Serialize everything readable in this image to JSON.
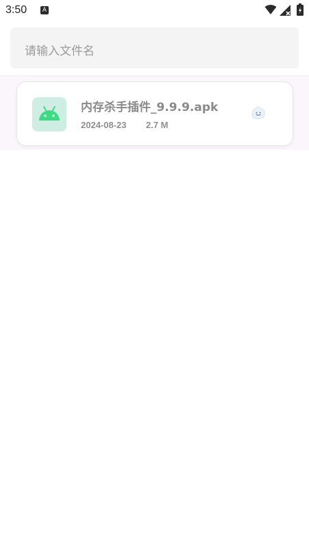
{
  "status_bar": {
    "time": "3:50",
    "notification_letter": "A"
  },
  "search": {
    "placeholder": "请输入文件名"
  },
  "files": [
    {
      "name": "内存杀手插件_9.9.9.apk",
      "date": "2024-08-23",
      "size": "2.7 M",
      "icon": "android-icon",
      "action_icon": "smiley-cloud-icon"
    }
  ],
  "colors": {
    "android_green": "#3ddc84",
    "icon_bg": "#cfeee3",
    "list_bg": "#fbf6fb",
    "search_bg": "#f4f4f4"
  }
}
